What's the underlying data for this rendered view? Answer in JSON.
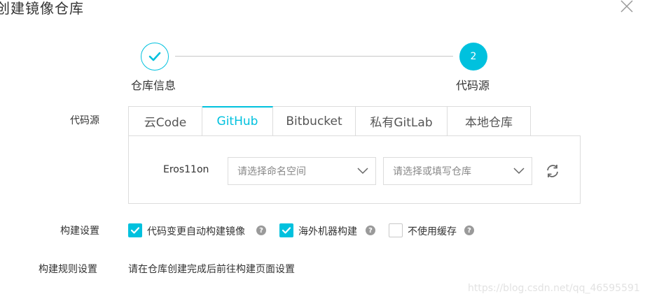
{
  "dialog": {
    "title": "创建镜像仓库"
  },
  "steps": [
    {
      "label": "仓库信息",
      "state": "done"
    },
    {
      "number": "2",
      "label": "代码源",
      "state": "current"
    }
  ],
  "form": {
    "source_label": "代码源",
    "build_label": "构建设置",
    "rule_label": "构建规则设置"
  },
  "tabs": [
    {
      "label": "云Code",
      "active": false
    },
    {
      "label": "GitHub",
      "active": true
    },
    {
      "label": "Bitbucket",
      "active": false
    },
    {
      "label": "私有GitLab",
      "active": false
    },
    {
      "label": "本地仓库",
      "active": false
    }
  ],
  "panel": {
    "account": "Eros11on",
    "namespace_placeholder": "请选择命名空间",
    "repo_placeholder": "请选择或填写仓库"
  },
  "build": {
    "options": [
      {
        "label": "代码变更自动构建镜像",
        "checked": true
      },
      {
        "label": "海外机器构建",
        "checked": true
      },
      {
        "label": "不使用缓存",
        "checked": false
      }
    ],
    "help_glyph": "?"
  },
  "rule": {
    "text": "请在仓库创建完成后前往构建页面设置"
  },
  "watermark": "https://blog.csdn.net/qq_46595591",
  "colors": {
    "accent": "#00c1de",
    "border": "#dcdcdc",
    "help": "#9a9a9a"
  }
}
